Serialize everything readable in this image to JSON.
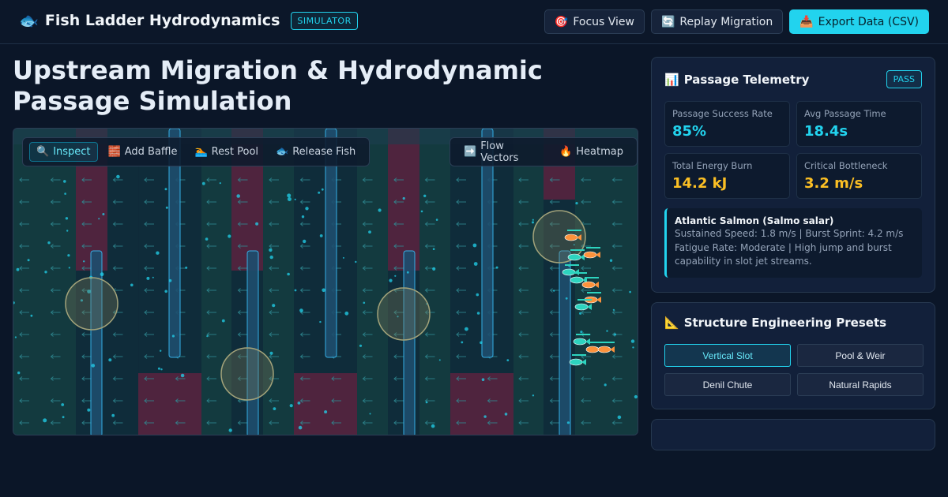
{
  "header": {
    "app_title": "Fish Ladder Hydrodynamics",
    "badge": "SIMULATOR",
    "buttons": {
      "focus": "Focus View",
      "replay": "Replay Migration",
      "export": "Export Data (CSV)"
    }
  },
  "main": {
    "title": "Upstream Migration & Hydrodynamic Passage Simulation"
  },
  "canvas_toolbar": {
    "tools": [
      {
        "label": "Inspect",
        "active": true
      },
      {
        "label": "Add Baffle",
        "active": false
      },
      {
        "label": "Rest Pool",
        "active": false
      },
      {
        "label": "Release Fish",
        "active": false
      }
    ],
    "overlays": [
      {
        "label": "Flow Vectors"
      },
      {
        "label": "Heatmap"
      }
    ]
  },
  "telemetry": {
    "title": "Passage Telemetry",
    "status": "PASS",
    "stats": [
      {
        "label": "Passage Success Rate",
        "value": "85%",
        "color": "#22d3ee"
      },
      {
        "label": "Avg Passage Time",
        "value": "18.4s",
        "color": "#22d3ee"
      },
      {
        "label": "Total Energy Burn",
        "value": "14.2 kJ",
        "color": "#fbbf24"
      },
      {
        "label": "Critical Bottleneck",
        "value": "3.2 m/s",
        "color": "#fbbf24"
      }
    ],
    "species": {
      "name": "Atlantic Salmon (Salmo salar)",
      "line1": "Sustained Speed: 1.8 m/s | Burst Sprint: 4.2 m/s",
      "line2": "Fatigue Rate: Moderate | High jump and burst capability in slot jet streams."
    }
  },
  "presets": {
    "title": "Structure Engineering Presets",
    "items": [
      {
        "label": "Vertical Slot",
        "active": true
      },
      {
        "label": "Pool & Weir",
        "active": false
      },
      {
        "label": "Denil Chute",
        "active": false
      },
      {
        "label": "Natural Rapids",
        "active": false
      }
    ]
  },
  "colors": {
    "accent": "#22d3ee",
    "warning": "#fbbf24",
    "water": "#133a3f",
    "high_velocity": "#5a2340",
    "fish_a": "#fb923c",
    "fish_b": "#2dd4bf"
  }
}
